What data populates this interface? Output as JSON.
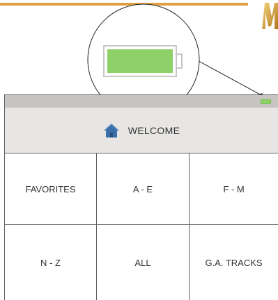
{
  "header": {
    "title": "WELCOME",
    "icon": "home-icon"
  },
  "status": {
    "battery_icon": "battery-icon",
    "battery_level": 1.0,
    "battery_color": "#8ed168"
  },
  "grid": {
    "tiles": [
      {
        "label": "FAVORITES"
      },
      {
        "label": "A - E"
      },
      {
        "label": "F - M"
      },
      {
        "label": "N - Z"
      },
      {
        "label": "ALL"
      },
      {
        "label": "G.A. TRACKS"
      }
    ]
  },
  "colors": {
    "accent_rule": "#e0a040",
    "home_icon": "#3a6ea8",
    "header_bg": "#e8e6e4",
    "status_bar_bg": "#c8c4c2"
  }
}
